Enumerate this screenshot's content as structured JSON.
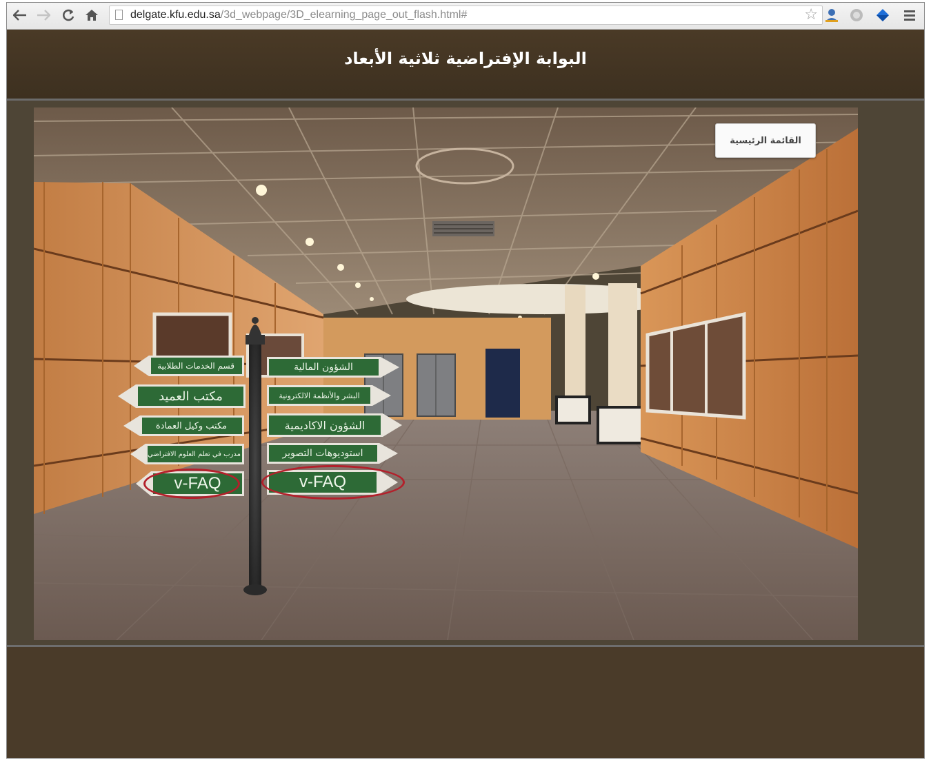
{
  "browser": {
    "url_host": "delgate.kfu.edu.sa",
    "url_path": "/3d_webpage/3D_elearning_page_out_flash.html#",
    "nav_icons": [
      "back-arrow-icon",
      "forward-arrow-icon",
      "reload-icon",
      "home-icon"
    ],
    "toolbar_icons": [
      "bookmark-star-icon",
      "user-profile-icon",
      "extension-globe-icon",
      "extension-diamond-icon",
      "menu-icon"
    ]
  },
  "page": {
    "title": "البوابة الإفتراضية ثلاثية الأبعاد",
    "main_menu_label": "القائمة الرئيسية"
  },
  "signs": {
    "left": [
      "قسم الخدمات الطلابية",
      "مكتب العميد",
      "مكتب وكيل العمادة",
      "مدرب في تعلم العلوم الافتراضي",
      "v-FAQ"
    ],
    "right": [
      "الشؤون المالية",
      "البشر والأنظمة الالكترونية",
      "الشؤون الاكاديمية",
      "استوديوهات التصوير",
      "v-FAQ"
    ]
  },
  "colors": {
    "header_bg": "#43341f",
    "sign_green": "#2d6a36",
    "highlight_red": "#b3202b"
  }
}
